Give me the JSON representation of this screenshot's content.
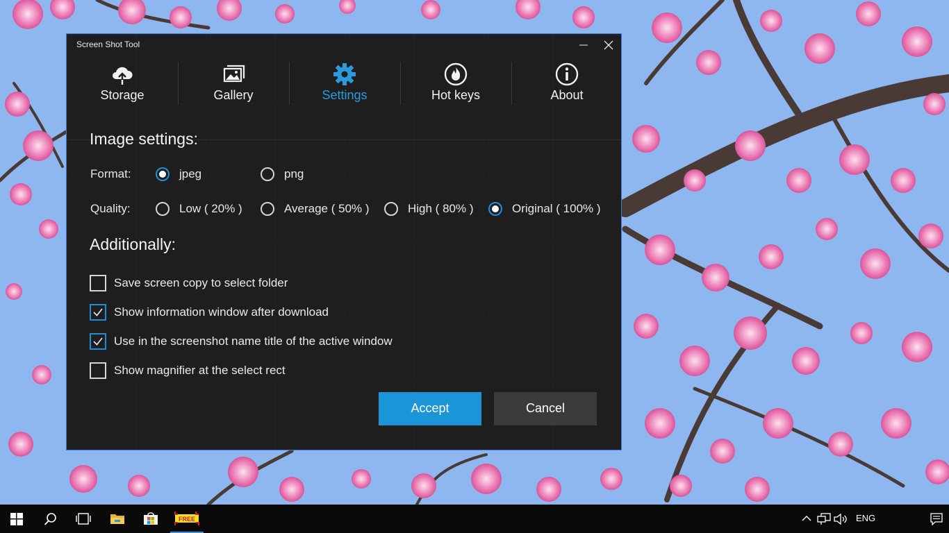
{
  "window": {
    "title": "Screen Shot Tool"
  },
  "nav": {
    "tabs": [
      {
        "label": "Storage",
        "icon": "cloud-upload-icon"
      },
      {
        "label": "Gallery",
        "icon": "gallery-icon"
      },
      {
        "label": "Settings",
        "icon": "gear-icon",
        "active": true
      },
      {
        "label": "Hot keys",
        "icon": "flame-icon"
      },
      {
        "label": "About",
        "icon": "info-icon"
      }
    ]
  },
  "settings": {
    "image_title": "Image settings:",
    "format_label": "Format:",
    "format_options": [
      {
        "label": "jpeg",
        "selected": true
      },
      {
        "label": "png",
        "selected": false
      }
    ],
    "quality_label": "Quality:",
    "quality_options": [
      {
        "label": "Low ( 20% )",
        "selected": false
      },
      {
        "label": "Average ( 50% )",
        "selected": false
      },
      {
        "label": "High ( 80% )",
        "selected": false
      },
      {
        "label": "Original ( 100% )",
        "selected": true
      }
    ],
    "additionally_title": "Additionally:",
    "checkboxes": [
      {
        "label": "Save screen copy to select folder",
        "checked": false
      },
      {
        "label": "Show information window after download",
        "checked": true
      },
      {
        "label": "Use in the screenshot name title of the active window",
        "checked": true
      },
      {
        "label": "Show magnifier at the select rect",
        "checked": false
      }
    ],
    "accept_label": "Accept",
    "cancel_label": "Cancel"
  },
  "taskbar": {
    "language": "ENG",
    "app_badge": "FREE",
    "icons": [
      "windows-start-icon",
      "search-icon",
      "task-view-icon",
      "file-explorer-icon",
      "store-icon",
      "screen-shot-tool-app-icon"
    ],
    "tray_icons": [
      "chevron-up-icon",
      "network-icon",
      "volume-icon",
      "notification-icon"
    ]
  },
  "colors": {
    "accent": "#1a95d8",
    "active_tab": "#2a9cdd",
    "window_bg": "#1e1e1f",
    "cancel_bg": "#3b3b3c",
    "sky": "#8db7ee",
    "blossom": "#e85fa4"
  }
}
